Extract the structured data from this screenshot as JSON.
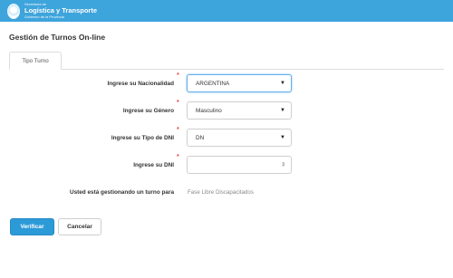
{
  "header": {
    "logo_line1": "Secretaría de",
    "logo_line2": "Logística y Transporte",
    "logo_line3": "Gobierno de la Provincia"
  },
  "page": {
    "title": "Gestión de Turnos On-line"
  },
  "tabs": [
    {
      "label": "Tipo Turno"
    }
  ],
  "form": {
    "nationality": {
      "label": "Ingrese su Nacionalidad",
      "value": "ARGENTINA"
    },
    "gender": {
      "label": "Ingrese su Género",
      "value": "Masculino"
    },
    "doc_type": {
      "label": "Ingrese su Tipo de DNI",
      "value": "DN"
    },
    "dni": {
      "label": "Ingrese su DNI",
      "value": ""
    },
    "turn_info": {
      "label": "Usted está gestionando un turno para",
      "value": "Fase Libre Discapacitados"
    }
  },
  "actions": {
    "verify_label": "Verificar",
    "cancel_label": "Cancelar"
  },
  "colors": {
    "header": "#3ea4dc",
    "primary": "#2d9ad8",
    "required": "#e04646",
    "focus": "#66afe9"
  },
  "icons": {
    "select_caret": "▼",
    "number_spinner": "⇕"
  }
}
